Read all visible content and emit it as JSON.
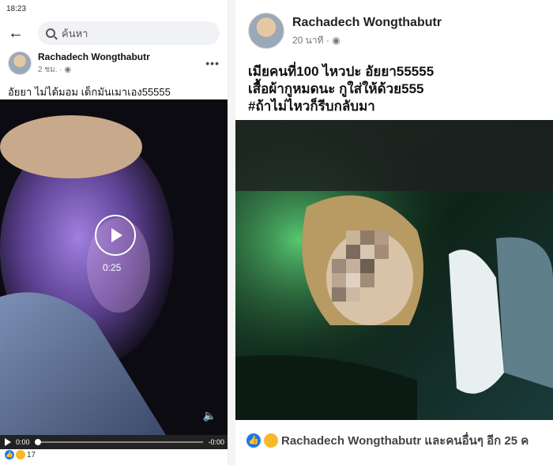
{
  "left": {
    "status": {
      "time": "18:23",
      "signal": ".ıl",
      "battery_label": ""
    },
    "search": {
      "placeholder": "ค้นหา"
    },
    "post": {
      "author": "Rachadech Wongthabutr",
      "meta": "2 ชม. · ",
      "caption": "อัยยา ไม่ได้มอม เด็กมันเมาเอง55555",
      "video_duration": "0:25",
      "time_current": "0:00",
      "time_remaining": "-0:00",
      "reaction_count": "17"
    }
  },
  "right": {
    "post": {
      "author": "Rachadech Wongthabutr",
      "meta": "20 นาที · ",
      "caption": "เมียคนที่100 ไหวปะ อัยยา55555\nเสื้อผ้ากูหมดนะ กูใส่ให้ด้วย555\n#ถ้าไม่ไหวก็รีบกลับมา",
      "reactions_text": "Rachadech Wongthabutr และคนอื่นๆ อีก 25 ค"
    }
  },
  "icons": {
    "back": "back-arrow-icon",
    "search": "search-icon",
    "more": "more-icon",
    "globe": "globe-icon",
    "play": "play-icon",
    "volume": "volume-icon",
    "like": "like-icon",
    "haha": "haha-icon"
  },
  "colors": {
    "brand": "#1877f2",
    "haha": "#f7b928"
  }
}
